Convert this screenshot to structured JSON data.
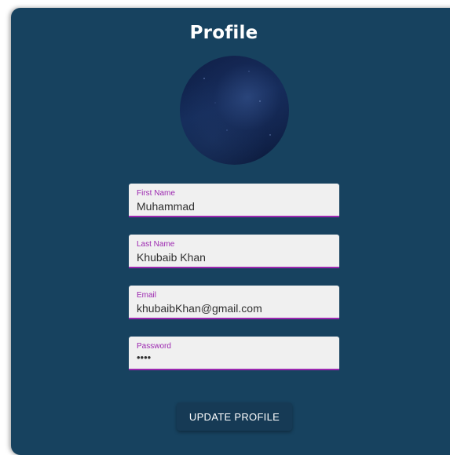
{
  "page": {
    "title": "Profile"
  },
  "avatar": {
    "icon": "profile-photo-night-sky"
  },
  "fields": {
    "first_name": {
      "label": "First Name",
      "value": "Muhammad"
    },
    "last_name": {
      "label": "Last Name",
      "value": "Khubaib Khan"
    },
    "email": {
      "label": "Email",
      "value": "khubaibKhan@gmail.com"
    },
    "password": {
      "label": "Password",
      "value": "••••"
    }
  },
  "actions": {
    "update_label": "UPDATE PROFILE"
  },
  "colors": {
    "card_background": "#17425f",
    "field_background": "#f0f0f0",
    "accent": "#9c27b0",
    "button_background": "#163a55"
  }
}
